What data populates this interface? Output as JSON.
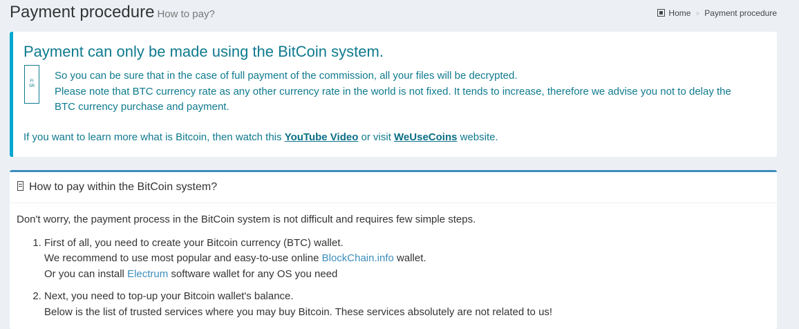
{
  "header": {
    "title": "Payment procedure",
    "subtitle": "How to pay?",
    "breadcrumb": {
      "home": "Home",
      "separator": ">",
      "current": "Payment procedure"
    }
  },
  "callout": {
    "heading": "Payment can only be made using the BitCoin system.",
    "icon": "bitcoin-icon",
    "line1": "So you can be sure that in the case of full payment of the commission, all your files will be decrypted.",
    "line2": "Please note that BTC currency rate as any other currency rate in the world is not fixed. It tends to increase, therefore we advise you not to delay the BTC currency purchase and payment.",
    "learn_prefix": "If you want to learn more what is Bitcoin, then watch this ",
    "youtube_link": "YouTube Video",
    "learn_middle": " or visit ",
    "wusecoins_link": "WeUseCoins",
    "learn_suffix": " website."
  },
  "howto": {
    "icon": "wallet-icon",
    "title": "How to pay within the BitCoin system?",
    "intro": "Don't worry, the payment process in the BitCoin system is not difficult and requires few simple steps.",
    "step1": {
      "line1": "First of all, you need to create your Bitcoin currency (BTC) wallet.",
      "line2_prefix": "We recommend to use most popular and easy-to-use online ",
      "line2_link": "BlockChain.info",
      "line2_suffix": " wallet.",
      "line3_prefix": "Or you can install ",
      "line3_link": "Electrum",
      "line3_suffix": " software wallet for any OS you need"
    },
    "step2": {
      "line1": "Next, you need to top-up your Bitcoin wallet's balance.",
      "line2": "Below is the list of trusted services where you may buy Bitcoin. These services absolutely are not related to us!"
    }
  },
  "colors": {
    "accent": "#00a7d0",
    "link": "#3c8dbc",
    "callout_text": "#0e7a8e",
    "background": "#ecf0f5"
  }
}
